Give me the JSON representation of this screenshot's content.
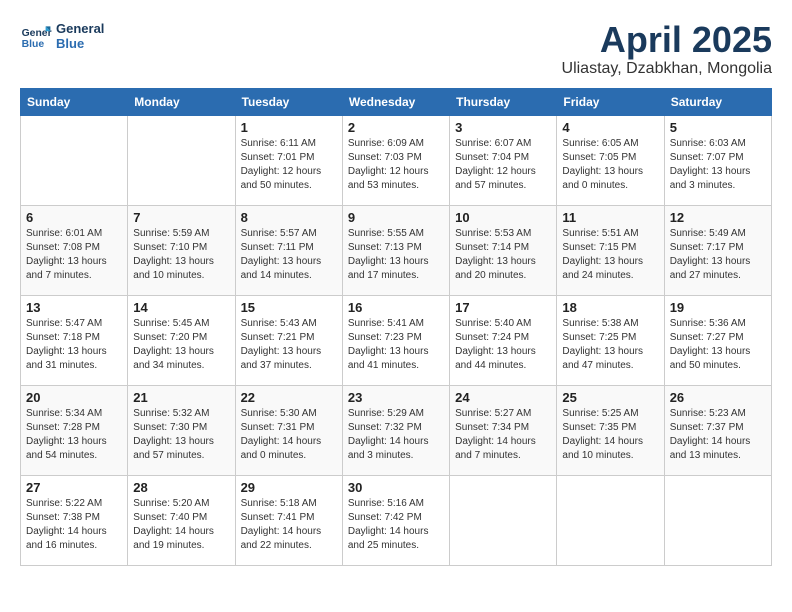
{
  "header": {
    "logo_line1": "General",
    "logo_line2": "Blue",
    "month": "April 2025",
    "location": "Uliastay, Dzabkhan, Mongolia"
  },
  "days_of_week": [
    "Sunday",
    "Monday",
    "Tuesday",
    "Wednesday",
    "Thursday",
    "Friday",
    "Saturday"
  ],
  "weeks": [
    [
      {
        "num": "",
        "detail": ""
      },
      {
        "num": "",
        "detail": ""
      },
      {
        "num": "1",
        "detail": "Sunrise: 6:11 AM\nSunset: 7:01 PM\nDaylight: 12 hours\nand 50 minutes."
      },
      {
        "num": "2",
        "detail": "Sunrise: 6:09 AM\nSunset: 7:03 PM\nDaylight: 12 hours\nand 53 minutes."
      },
      {
        "num": "3",
        "detail": "Sunrise: 6:07 AM\nSunset: 7:04 PM\nDaylight: 12 hours\nand 57 minutes."
      },
      {
        "num": "4",
        "detail": "Sunrise: 6:05 AM\nSunset: 7:05 PM\nDaylight: 13 hours\nand 0 minutes."
      },
      {
        "num": "5",
        "detail": "Sunrise: 6:03 AM\nSunset: 7:07 PM\nDaylight: 13 hours\nand 3 minutes."
      }
    ],
    [
      {
        "num": "6",
        "detail": "Sunrise: 6:01 AM\nSunset: 7:08 PM\nDaylight: 13 hours\nand 7 minutes."
      },
      {
        "num": "7",
        "detail": "Sunrise: 5:59 AM\nSunset: 7:10 PM\nDaylight: 13 hours\nand 10 minutes."
      },
      {
        "num": "8",
        "detail": "Sunrise: 5:57 AM\nSunset: 7:11 PM\nDaylight: 13 hours\nand 14 minutes."
      },
      {
        "num": "9",
        "detail": "Sunrise: 5:55 AM\nSunset: 7:13 PM\nDaylight: 13 hours\nand 17 minutes."
      },
      {
        "num": "10",
        "detail": "Sunrise: 5:53 AM\nSunset: 7:14 PM\nDaylight: 13 hours\nand 20 minutes."
      },
      {
        "num": "11",
        "detail": "Sunrise: 5:51 AM\nSunset: 7:15 PM\nDaylight: 13 hours\nand 24 minutes."
      },
      {
        "num": "12",
        "detail": "Sunrise: 5:49 AM\nSunset: 7:17 PM\nDaylight: 13 hours\nand 27 minutes."
      }
    ],
    [
      {
        "num": "13",
        "detail": "Sunrise: 5:47 AM\nSunset: 7:18 PM\nDaylight: 13 hours\nand 31 minutes."
      },
      {
        "num": "14",
        "detail": "Sunrise: 5:45 AM\nSunset: 7:20 PM\nDaylight: 13 hours\nand 34 minutes."
      },
      {
        "num": "15",
        "detail": "Sunrise: 5:43 AM\nSunset: 7:21 PM\nDaylight: 13 hours\nand 37 minutes."
      },
      {
        "num": "16",
        "detail": "Sunrise: 5:41 AM\nSunset: 7:23 PM\nDaylight: 13 hours\nand 41 minutes."
      },
      {
        "num": "17",
        "detail": "Sunrise: 5:40 AM\nSunset: 7:24 PM\nDaylight: 13 hours\nand 44 minutes."
      },
      {
        "num": "18",
        "detail": "Sunrise: 5:38 AM\nSunset: 7:25 PM\nDaylight: 13 hours\nand 47 minutes."
      },
      {
        "num": "19",
        "detail": "Sunrise: 5:36 AM\nSunset: 7:27 PM\nDaylight: 13 hours\nand 50 minutes."
      }
    ],
    [
      {
        "num": "20",
        "detail": "Sunrise: 5:34 AM\nSunset: 7:28 PM\nDaylight: 13 hours\nand 54 minutes."
      },
      {
        "num": "21",
        "detail": "Sunrise: 5:32 AM\nSunset: 7:30 PM\nDaylight: 13 hours\nand 57 minutes."
      },
      {
        "num": "22",
        "detail": "Sunrise: 5:30 AM\nSunset: 7:31 PM\nDaylight: 14 hours\nand 0 minutes."
      },
      {
        "num": "23",
        "detail": "Sunrise: 5:29 AM\nSunset: 7:32 PM\nDaylight: 14 hours\nand 3 minutes."
      },
      {
        "num": "24",
        "detail": "Sunrise: 5:27 AM\nSunset: 7:34 PM\nDaylight: 14 hours\nand 7 minutes."
      },
      {
        "num": "25",
        "detail": "Sunrise: 5:25 AM\nSunset: 7:35 PM\nDaylight: 14 hours\nand 10 minutes."
      },
      {
        "num": "26",
        "detail": "Sunrise: 5:23 AM\nSunset: 7:37 PM\nDaylight: 14 hours\nand 13 minutes."
      }
    ],
    [
      {
        "num": "27",
        "detail": "Sunrise: 5:22 AM\nSunset: 7:38 PM\nDaylight: 14 hours\nand 16 minutes."
      },
      {
        "num": "28",
        "detail": "Sunrise: 5:20 AM\nSunset: 7:40 PM\nDaylight: 14 hours\nand 19 minutes."
      },
      {
        "num": "29",
        "detail": "Sunrise: 5:18 AM\nSunset: 7:41 PM\nDaylight: 14 hours\nand 22 minutes."
      },
      {
        "num": "30",
        "detail": "Sunrise: 5:16 AM\nSunset: 7:42 PM\nDaylight: 14 hours\nand 25 minutes."
      },
      {
        "num": "",
        "detail": ""
      },
      {
        "num": "",
        "detail": ""
      },
      {
        "num": "",
        "detail": ""
      }
    ]
  ]
}
